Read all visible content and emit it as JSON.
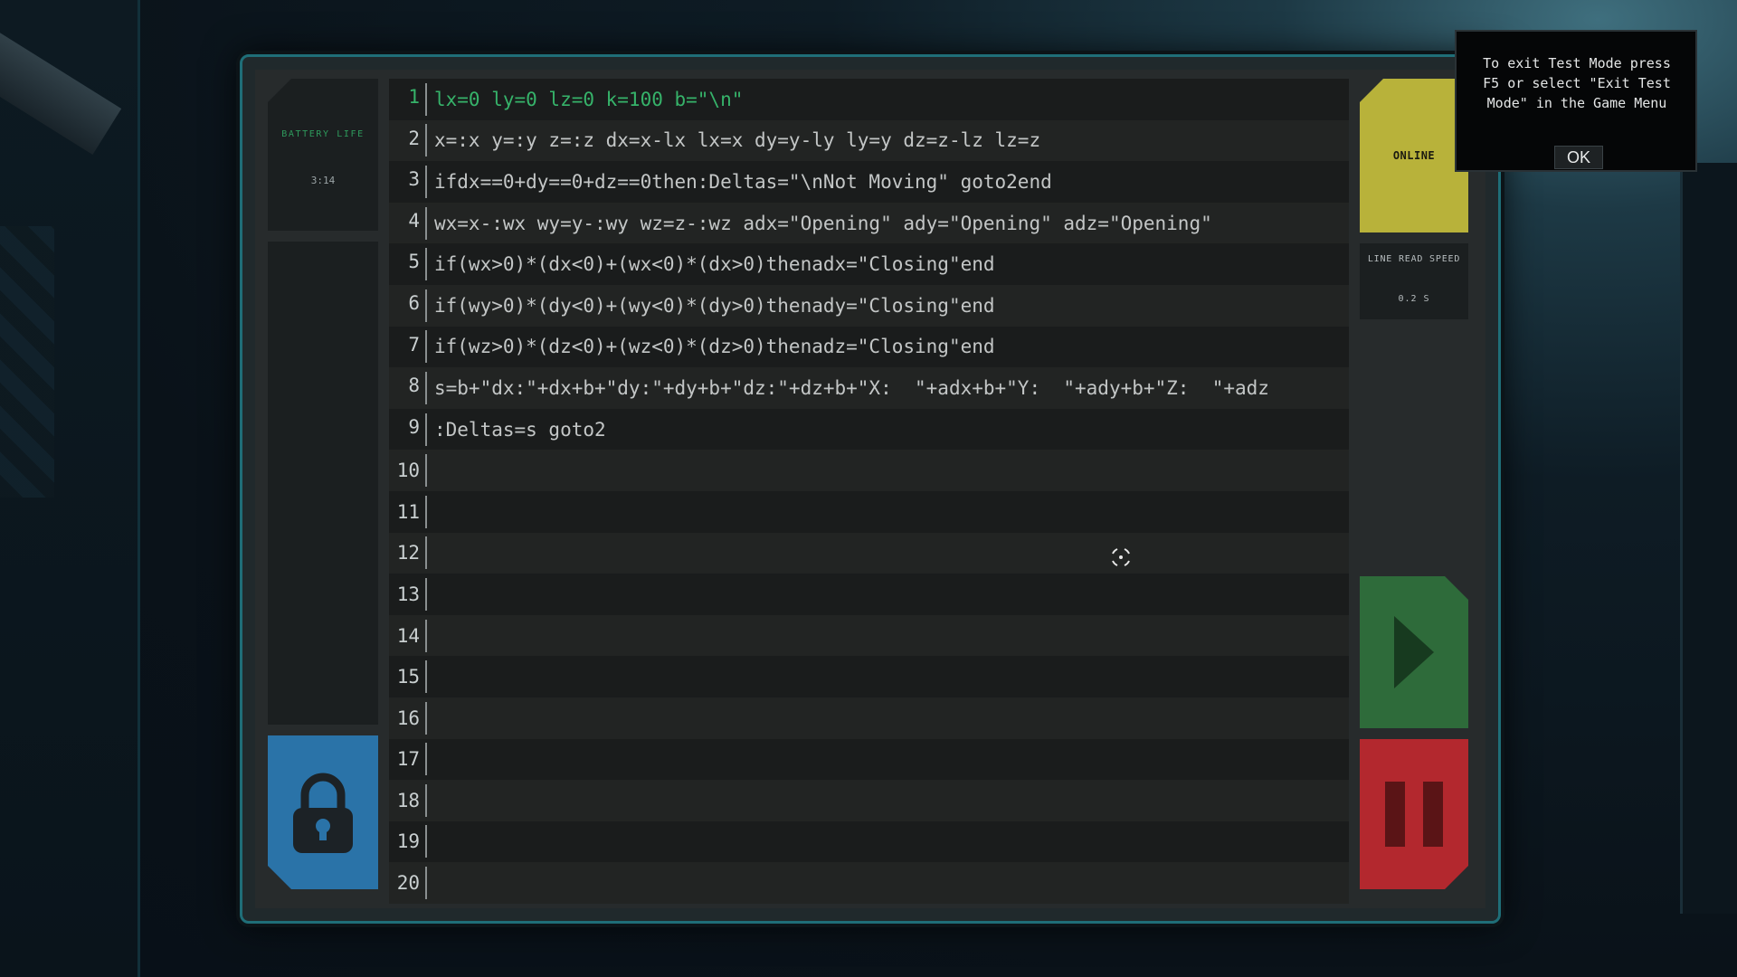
{
  "battery": {
    "label": "BATTERY LIFE",
    "value": "3:14"
  },
  "status": {
    "label": "ONLINE",
    "color": "#b8b23a"
  },
  "line_read_speed": {
    "label": "LINE READ SPEED",
    "value": "0.2 S"
  },
  "dialog": {
    "message": "To exit Test Mode press\nF5 or select \"Exit Test\nMode\" in the Game Menu",
    "ok_label": "OK"
  },
  "editor": {
    "active_line": 1,
    "lines": [
      {
        "num": "1",
        "code": "lx=0 ly=0 lz=0 k=100 b=\"\\n\""
      },
      {
        "num": "2",
        "code": "x=:x y=:y z=:z dx=x-lx lx=x dy=y-ly ly=y dz=z-lz lz=z"
      },
      {
        "num": "3",
        "code": "ifdx==0+dy==0+dz==0then:Deltas=\"\\nNot Moving\" goto2end"
      },
      {
        "num": "4",
        "code": "wx=x-:wx wy=y-:wy wz=z-:wz adx=\"Opening\" ady=\"Opening\" adz=\"Opening\""
      },
      {
        "num": "5",
        "code": "if(wx>0)*(dx<0)+(wx<0)*(dx>0)thenadx=\"Closing\"end"
      },
      {
        "num": "6",
        "code": "if(wy>0)*(dy<0)+(wy<0)*(dy>0)thenady=\"Closing\"end"
      },
      {
        "num": "7",
        "code": "if(wz>0)*(dz<0)+(wz<0)*(dz>0)thenadz=\"Closing\"end"
      },
      {
        "num": "8",
        "code": "s=b+\"dx:\"+dx+b+\"dy:\"+dy+b+\"dz:\"+dz+b+\"X:  \"+adx+b+\"Y:  \"+ady+b+\"Z:  \"+adz"
      },
      {
        "num": "9",
        "code": ":Deltas=s goto2"
      },
      {
        "num": "10",
        "code": ""
      },
      {
        "num": "11",
        "code": ""
      },
      {
        "num": "12",
        "code": ""
      },
      {
        "num": "13",
        "code": ""
      },
      {
        "num": "14",
        "code": ""
      },
      {
        "num": "15",
        "code": ""
      },
      {
        "num": "16",
        "code": ""
      },
      {
        "num": "17",
        "code": ""
      },
      {
        "num": "18",
        "code": ""
      },
      {
        "num": "19",
        "code": ""
      },
      {
        "num": "20",
        "code": ""
      }
    ]
  },
  "icons": {
    "lock": "lock-icon",
    "play": "play-icon",
    "pause": "pause-icon",
    "cursor": "crosshair-icon"
  },
  "colors": {
    "lock_button": "#2a73a8",
    "play_button": "#2e6b3a",
    "pause_button": "#b3282e",
    "active_text": "#36b36a"
  }
}
